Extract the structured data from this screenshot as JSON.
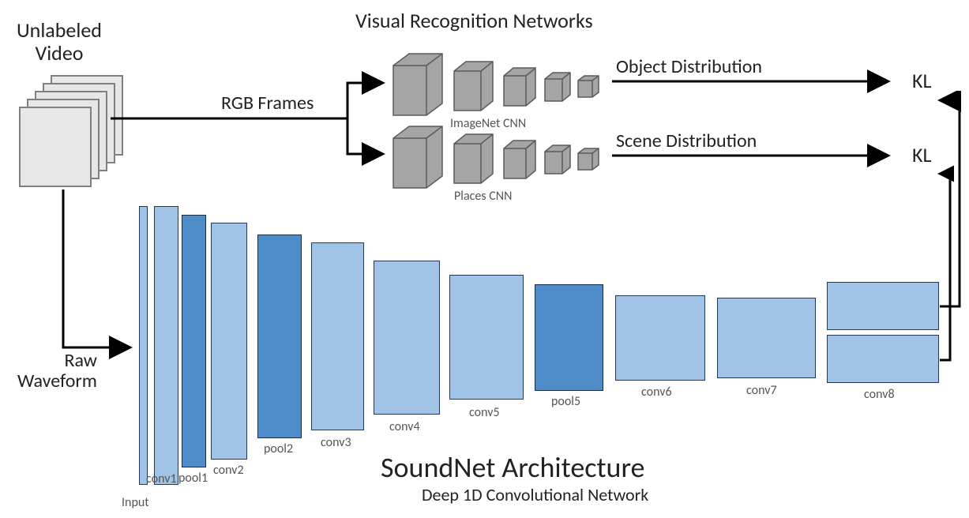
{
  "labels": {
    "unlabeled_video": "Unlabeled\nVideo",
    "rgb_frames": "RGB Frames",
    "visual_recog": "Visual Recognition Networks",
    "imagenet_cnn": "ImageNet CNN",
    "places_cnn": "Places CNN",
    "object_dist": "Object Distribution",
    "scene_dist": "Scene Distribution",
    "kl_top": "KL",
    "kl_bottom": "KL",
    "raw_waveform": "Raw\nWaveform",
    "title": "SoundNet Architecture",
    "subtitle": "Deep 1D Convolutional Network"
  },
  "layers": {
    "input": "Input",
    "conv1": "conv1",
    "pool1": "pool1",
    "conv2": "conv2",
    "pool2": "pool2",
    "conv3": "conv3",
    "conv4": "conv4",
    "conv5": "conv5",
    "pool5": "pool5",
    "conv6": "conv6",
    "conv7": "conv7",
    "conv8": "conv8"
  }
}
